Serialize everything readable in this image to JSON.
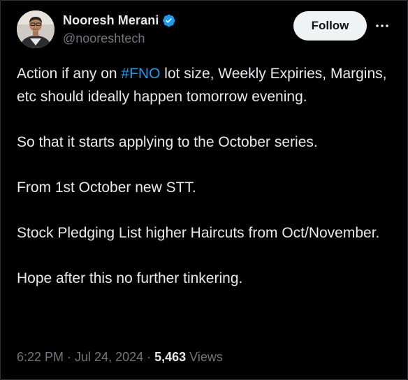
{
  "author": {
    "display_name": "Nooresh Merani",
    "handle": "@nooreshtech",
    "verified": true
  },
  "actions": {
    "follow_label": "Follow",
    "more_icon": "more-horizontal-icon"
  },
  "tweet": {
    "line1_before": "Action if any on ",
    "hashtag": "#FNO",
    "line1_after": " lot size, Weekly Expiries, Margins, etc should ideally happen tomorrow evening.",
    "para2": "So that it starts applying to the October series.",
    "para3": "From 1st October new STT.",
    "para4": "Stock Pledging List higher Haircuts from Oct/November.",
    "para5": "Hope after this no further tinkering."
  },
  "meta": {
    "time": "6:22 PM",
    "separator": " · ",
    "date": "Jul 24, 2024",
    "views_count": "5,463",
    "views_label": " Views"
  },
  "colors": {
    "background": "#000000",
    "text": "#e7e9ea",
    "muted": "#71767b",
    "link": "#1d9bf0",
    "verified": "#1d9bf0",
    "follow_bg": "#eff3f4"
  }
}
